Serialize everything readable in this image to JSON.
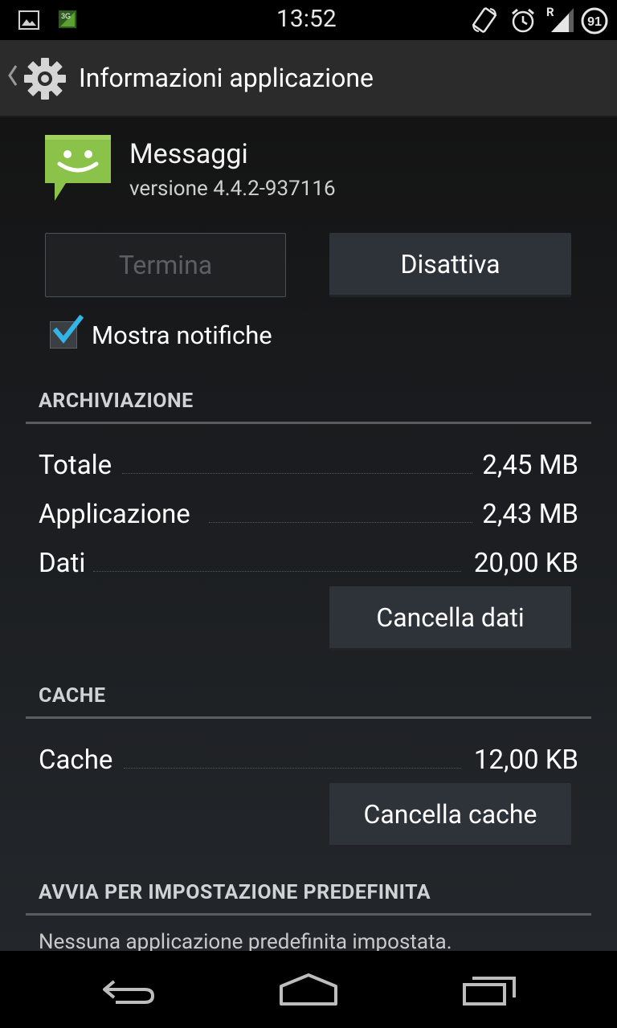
{
  "status_bar": {
    "time": "13:52",
    "network_badge": "3G",
    "signal_label": "R",
    "battery_level": "91",
    "icons": [
      "gallery-icon",
      "network-3g-icon",
      "rotate-icon",
      "alarm-icon",
      "signal-icon",
      "battery-icon"
    ]
  },
  "action_bar": {
    "title": "Informazioni applicazione"
  },
  "app": {
    "name": "Messaggi",
    "version": "versione 4.4.2-937116"
  },
  "buttons": {
    "force_stop": "Termina",
    "disable": "Disattiva",
    "clear_data": "Cancella dati",
    "clear_cache": "Cancella cache"
  },
  "notifications": {
    "label": "Mostra notifiche",
    "checked": true
  },
  "storage": {
    "header": "ARCHIVIAZIONE",
    "rows": [
      {
        "label": "Totale",
        "value": "2,45 MB"
      },
      {
        "label": "Applicazione",
        "value": "2,43 MB"
      },
      {
        "label": "Dati",
        "value": "20,00 KB"
      }
    ]
  },
  "cache": {
    "header": "CACHE",
    "rows": [
      {
        "label": "Cache",
        "value": "12,00 KB"
      }
    ]
  },
  "launch_default": {
    "header": "AVVIA PER IMPOSTAZIONE PREDEFINITA",
    "text": "Nessuna applicazione predefinita impostata."
  },
  "colors": {
    "accent_check": "#33b5e5",
    "app_icon_green": "#8bc34a"
  }
}
